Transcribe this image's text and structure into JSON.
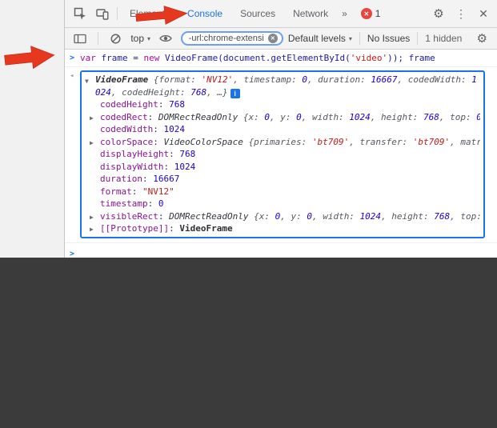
{
  "colors": {
    "accent-blue": "#1a73e8",
    "badge-red": "#e8453c",
    "arrow-red": "#e6381f",
    "toolbar-bg": "#f3f3f3",
    "border": "#d0d0d0",
    "dark-page": "#3b3b3b",
    "light-page": "#f1f1f1",
    "tok-keyword": "#aa0d91",
    "tok-ident": "#1a1aa6",
    "tok-string": "#c41a16",
    "tok-number": "#1c00cf",
    "tok-propname": "#881391"
  },
  "glyphs": {
    "gear": "⚙",
    "kebab": "⋮",
    "x": "✕",
    "caret": "▾",
    "prompt": ">",
    "result_marker": "◂",
    "tri_open": "▼",
    "tri_closed": "▶",
    "info": "i",
    "more": "»"
  },
  "devtools": {
    "tabbar": {
      "tabs": [
        {
          "label": "Elements"
        },
        {
          "label": "Console"
        },
        {
          "label": "Sources"
        },
        {
          "label": "Network"
        }
      ],
      "error_count": "1"
    },
    "toolbar": {
      "context_selector": "top",
      "filter_value": "-url:chrome-extensi",
      "levels_selector": "Default levels",
      "issues_label": "No Issues",
      "hidden_count_label": "1 hidden"
    },
    "console": {
      "command": {
        "segments": [
          {
            "t": "var",
            "c": "kw"
          },
          {
            "t": " frame = ",
            "c": "ident"
          },
          {
            "t": "new",
            "c": "kw"
          },
          {
            "t": " VideoFrame(document.getElementById(",
            "c": "ident"
          },
          {
            "t": "'video'",
            "c": "str"
          },
          {
            "t": ")); frame",
            "c": "ident"
          }
        ]
      },
      "result": {
        "preview_segments": [
          {
            "t": "VideoFrame ",
            "c": "objname"
          },
          {
            "t": "{format: ",
            "c": "pkey"
          },
          {
            "t": "'NV12'",
            "c": "pstr"
          },
          {
            "t": ", timestamp: ",
            "c": "pkey"
          },
          {
            "t": "0",
            "c": "pnum"
          },
          {
            "t": ", duration: ",
            "c": "pkey"
          },
          {
            "t": "16667",
            "c": "pnum"
          },
          {
            "t": ", codedWidth: ",
            "c": "pkey"
          },
          {
            "t": "1024",
            "c": "pnum"
          },
          {
            "t": ", codedHeight: ",
            "c": "pkey"
          },
          {
            "t": "768",
            "c": "pnum"
          },
          {
            "t": ", …}",
            "c": "pkey"
          }
        ],
        "properties": [
          {
            "name": "codedHeight",
            "expandable": false,
            "value": [
              {
                "t": "768",
                "c": "num"
              }
            ]
          },
          {
            "name": "codedRect",
            "expandable": true,
            "value": [
              {
                "t": "DOMRectReadOnly ",
                "c": "pobj"
              },
              {
                "t": "{x: ",
                "c": "pkey"
              },
              {
                "t": "0",
                "c": "pnum"
              },
              {
                "t": ", y: ",
                "c": "pkey"
              },
              {
                "t": "0",
                "c": "pnum"
              },
              {
                "t": ", width: ",
                "c": "pkey"
              },
              {
                "t": "1024",
                "c": "pnum"
              },
              {
                "t": ", height: ",
                "c": "pkey"
              },
              {
                "t": "768",
                "c": "pnum"
              },
              {
                "t": ", top: ",
                "c": "pkey"
              },
              {
                "t": "0",
                "c": "pnum"
              },
              {
                "t": ",",
                "c": "pkey"
              }
            ]
          },
          {
            "name": "codedWidth",
            "expandable": false,
            "value": [
              {
                "t": "1024",
                "c": "num"
              }
            ]
          },
          {
            "name": "colorSpace",
            "expandable": true,
            "value": [
              {
                "t": "VideoColorSpace ",
                "c": "pobj"
              },
              {
                "t": "{primaries: ",
                "c": "pkey"
              },
              {
                "t": "'bt709'",
                "c": "pstr"
              },
              {
                "t": ", transfer: ",
                "c": "pkey"
              },
              {
                "t": "'bt709'",
                "c": "pstr"
              },
              {
                "t": ", matri",
                "c": "pkey"
              }
            ]
          },
          {
            "name": "displayHeight",
            "expandable": false,
            "value": [
              {
                "t": "768",
                "c": "num"
              }
            ]
          },
          {
            "name": "displayWidth",
            "expandable": false,
            "value": [
              {
                "t": "1024",
                "c": "num"
              }
            ]
          },
          {
            "name": "duration",
            "expandable": false,
            "value": [
              {
                "t": "16667",
                "c": "num"
              }
            ]
          },
          {
            "name": "format",
            "expandable": false,
            "value": [
              {
                "t": "\"NV12\"",
                "c": "str"
              }
            ]
          },
          {
            "name": "timestamp",
            "expandable": false,
            "value": [
              {
                "t": "0",
                "c": "num"
              }
            ]
          },
          {
            "name": "visibleRect",
            "expandable": true,
            "value": [
              {
                "t": "DOMRectReadOnly ",
                "c": "pobj"
              },
              {
                "t": "{x: ",
                "c": "pkey"
              },
              {
                "t": "0",
                "c": "pnum"
              },
              {
                "t": ", y: ",
                "c": "pkey"
              },
              {
                "t": "0",
                "c": "pnum"
              },
              {
                "t": ", width: ",
                "c": "pkey"
              },
              {
                "t": "1024",
                "c": "pnum"
              },
              {
                "t": ", height: ",
                "c": "pkey"
              },
              {
                "t": "768",
                "c": "pnum"
              },
              {
                "t": ", top:",
                "c": "pkey"
              }
            ]
          },
          {
            "name": "[[Prototype]]",
            "expandable": true,
            "value": [
              {
                "t": "VideoFrame",
                "c": "proto"
              }
            ]
          }
        ]
      }
    }
  }
}
